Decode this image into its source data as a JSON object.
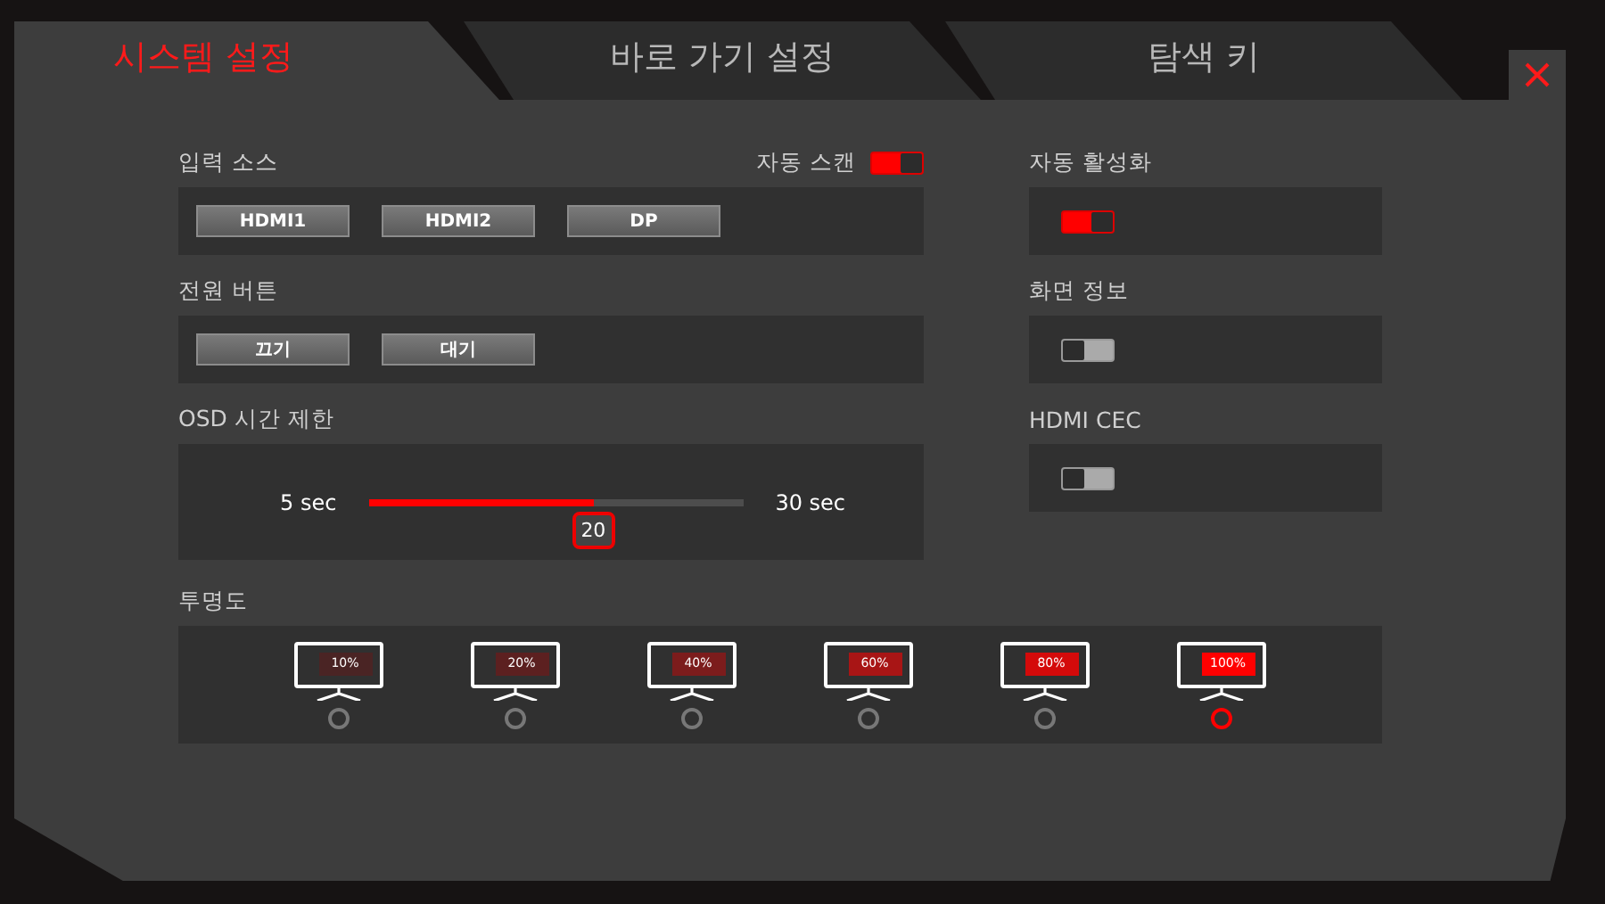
{
  "tabs": [
    {
      "label": "시스템 설정",
      "selected": true
    },
    {
      "label": "바로 가기 설정",
      "selected": false
    },
    {
      "label": "탐색 키",
      "selected": false
    }
  ],
  "input_source": {
    "label": "입력 소스",
    "auto_scan": {
      "label": "자동 스캔",
      "on": true
    },
    "buttons": [
      "HDMI1",
      "HDMI2",
      "DP"
    ]
  },
  "power_button": {
    "label": "전원 버튼",
    "buttons": [
      "끄기",
      "대기"
    ]
  },
  "osd_timeout": {
    "label": "OSD 시간 제한",
    "min": "5 sec",
    "max": "30 sec",
    "level": 0.6,
    "value": "20"
  },
  "toggles": [
    {
      "label": "자동 활성화",
      "on": true
    },
    {
      "label": "화면 정보",
      "on": false
    },
    {
      "label": "HDMI CEC",
      "on": false
    }
  ],
  "transparency": {
    "label": "투명도",
    "options": [
      {
        "label": "10%",
        "color": "#4a2424",
        "selected": false
      },
      {
        "label": "20%",
        "color": "#5c2020",
        "selected": false
      },
      {
        "label": "40%",
        "color": "#7c1c1c",
        "selected": false
      },
      {
        "label": "60%",
        "color": "#a81515",
        "selected": false
      },
      {
        "label": "80%",
        "color": "#d40a0a",
        "selected": false
      },
      {
        "label": "100%",
        "color": "#ff0000",
        "selected": true
      }
    ]
  }
}
